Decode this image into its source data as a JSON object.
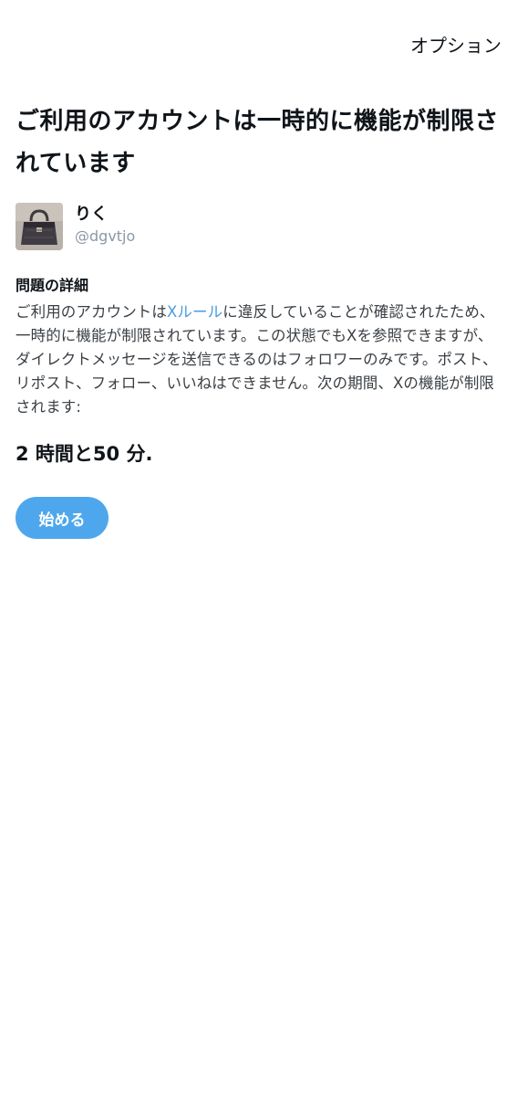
{
  "header": {
    "options_label": "オプション"
  },
  "title": "ご利用のアカウントは一時的に機能が制限されています",
  "user": {
    "display_name": "りく",
    "handle": "@dgvtjo"
  },
  "details": {
    "heading": "問題の詳細",
    "body_prefix": "ご利用のアカウントは",
    "rules_link": "Xルール",
    "body_suffix": "に違反していることが確認されたため、一時的に機能が制限されています。この状態でもXを参照できますが、ダイレクトメッセージを送信できるのはフォロワーのみです。ポスト、リポスト、フォロー、いいねはできません。次の期間、Xの機能が制限されます:"
  },
  "duration": "2 時間と50 分.",
  "start_button_label": "始める",
  "colors": {
    "accent": "#4ea7ec",
    "link": "#4a9be0",
    "secondary_text": "#8b98a5"
  }
}
